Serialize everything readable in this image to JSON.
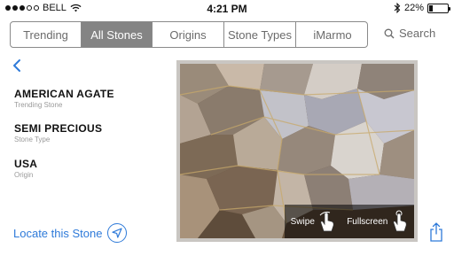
{
  "status_bar": {
    "carrier": "BELL",
    "time": "4:21 PM",
    "battery_percent": "22%",
    "battery_level": 0.22,
    "signal_bars_filled": 3,
    "signal_bars_total": 5
  },
  "tabs": [
    {
      "label": "Trending",
      "active": false
    },
    {
      "label": "All Stones",
      "active": true
    },
    {
      "label": "Origins",
      "active": false
    },
    {
      "label": "Stone Types",
      "active": false
    },
    {
      "label": "iMarmo",
      "active": false
    }
  ],
  "search": {
    "label": "Search"
  },
  "stone": {
    "name": "AMERICAN AGATE",
    "name_caption": "Trending Stone",
    "type": "SEMI PRECIOUS",
    "type_caption": "Stone Type",
    "origin": "USA",
    "origin_caption": "Origin"
  },
  "locate": {
    "label": "Locate this Stone"
  },
  "image_controls": {
    "swipe_label": "Swipe",
    "fullscreen_label": "Fullscreen"
  },
  "colors": {
    "accent": "#2e7ad9",
    "tab_active_bg": "#848484",
    "tab_text": "#6b6b6b"
  },
  "icons": {
    "back": "chevron-left-icon",
    "search": "magnifier-icon",
    "locate": "location-arrow-icon",
    "swipe": "hand-swipe-icon",
    "fullscreen": "hand-tap-icon",
    "share": "share-icon"
  }
}
